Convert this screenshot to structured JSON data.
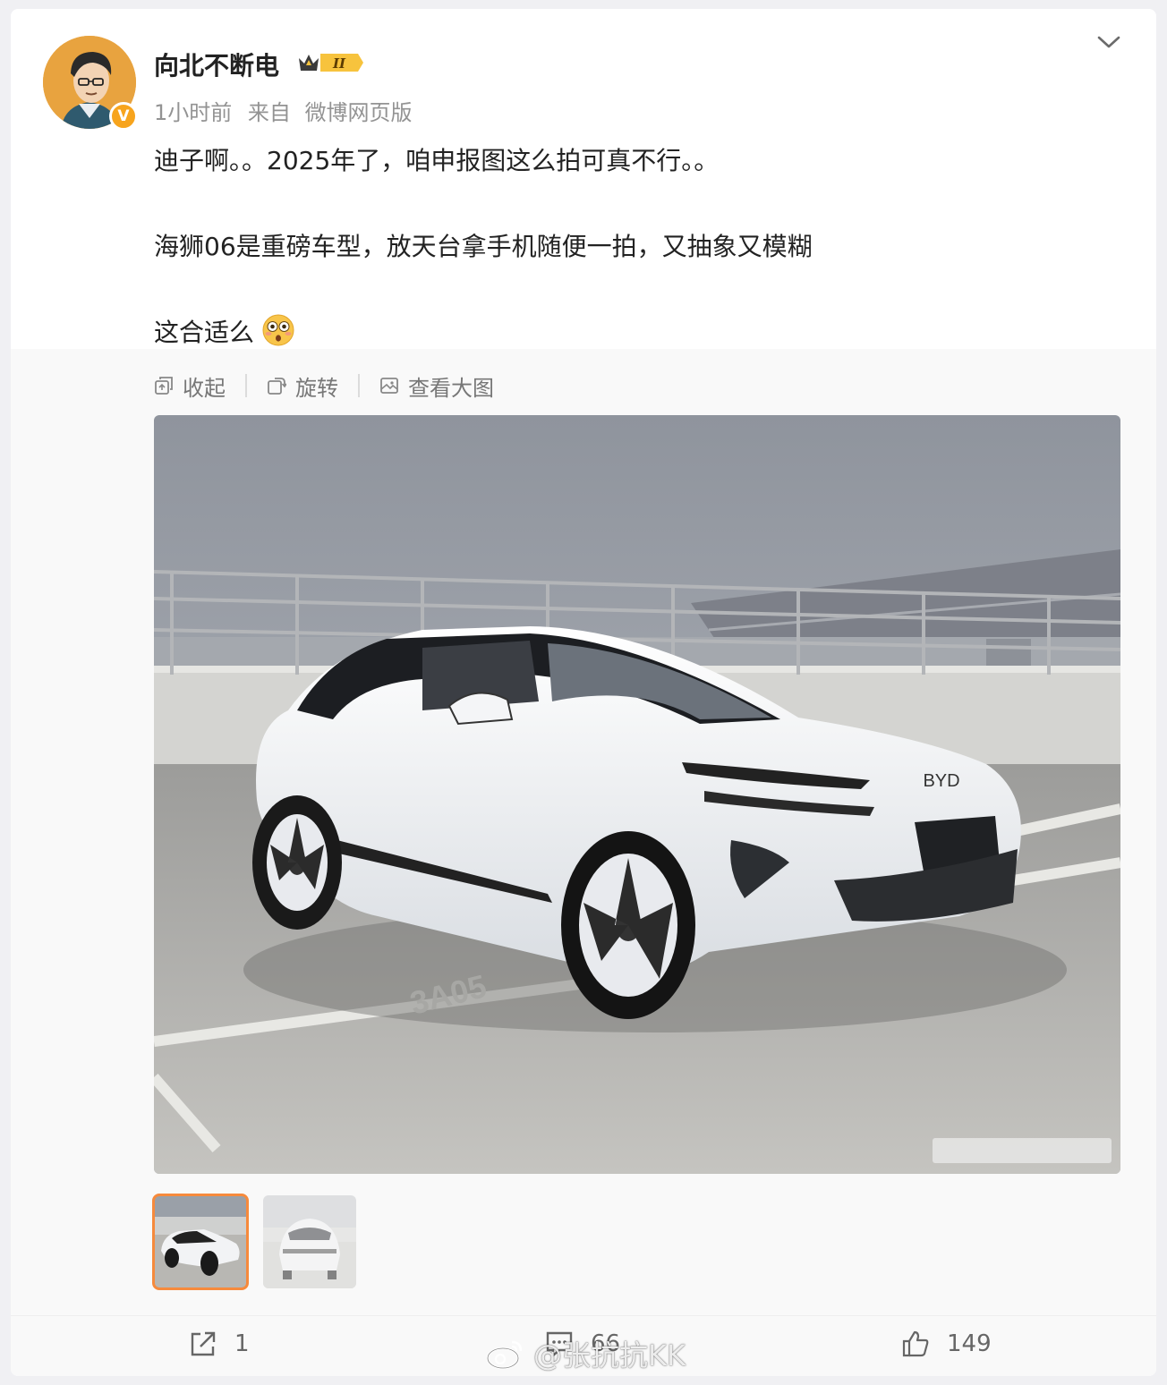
{
  "post": {
    "username": "向北不断电",
    "rank_badge": "II",
    "time_ago": "1小时前",
    "source_prefix": "来自",
    "source": "微博网页版",
    "lines": [
      "迪子啊。。2025年了，咱申报图这么拍可真不行。。",
      "海狮06是重磅车型，放天台拿手机随便一拍，又抽象又模糊",
      "这合适么"
    ],
    "emoji": "flushed-face-emoji"
  },
  "media_toolbar": {
    "collapse_label": "收起",
    "rotate_label": "旋转",
    "view_large_label": "查看大图"
  },
  "photo": {
    "plate_text": "3A05",
    "logo_text": "BYD"
  },
  "thumbnails": [
    {
      "label": "thumbnail-front",
      "active": true
    },
    {
      "label": "thumbnail-rear",
      "active": false
    }
  ],
  "actions": {
    "repost_count": "1",
    "comment_count": "66",
    "like_count": "149"
  },
  "watermark": "@张抗抗KK",
  "colors": {
    "accent_orange": "#f68a3c",
    "verified_badge": "#f7a41d",
    "text_primary": "#222222",
    "text_secondary": "#939393"
  }
}
